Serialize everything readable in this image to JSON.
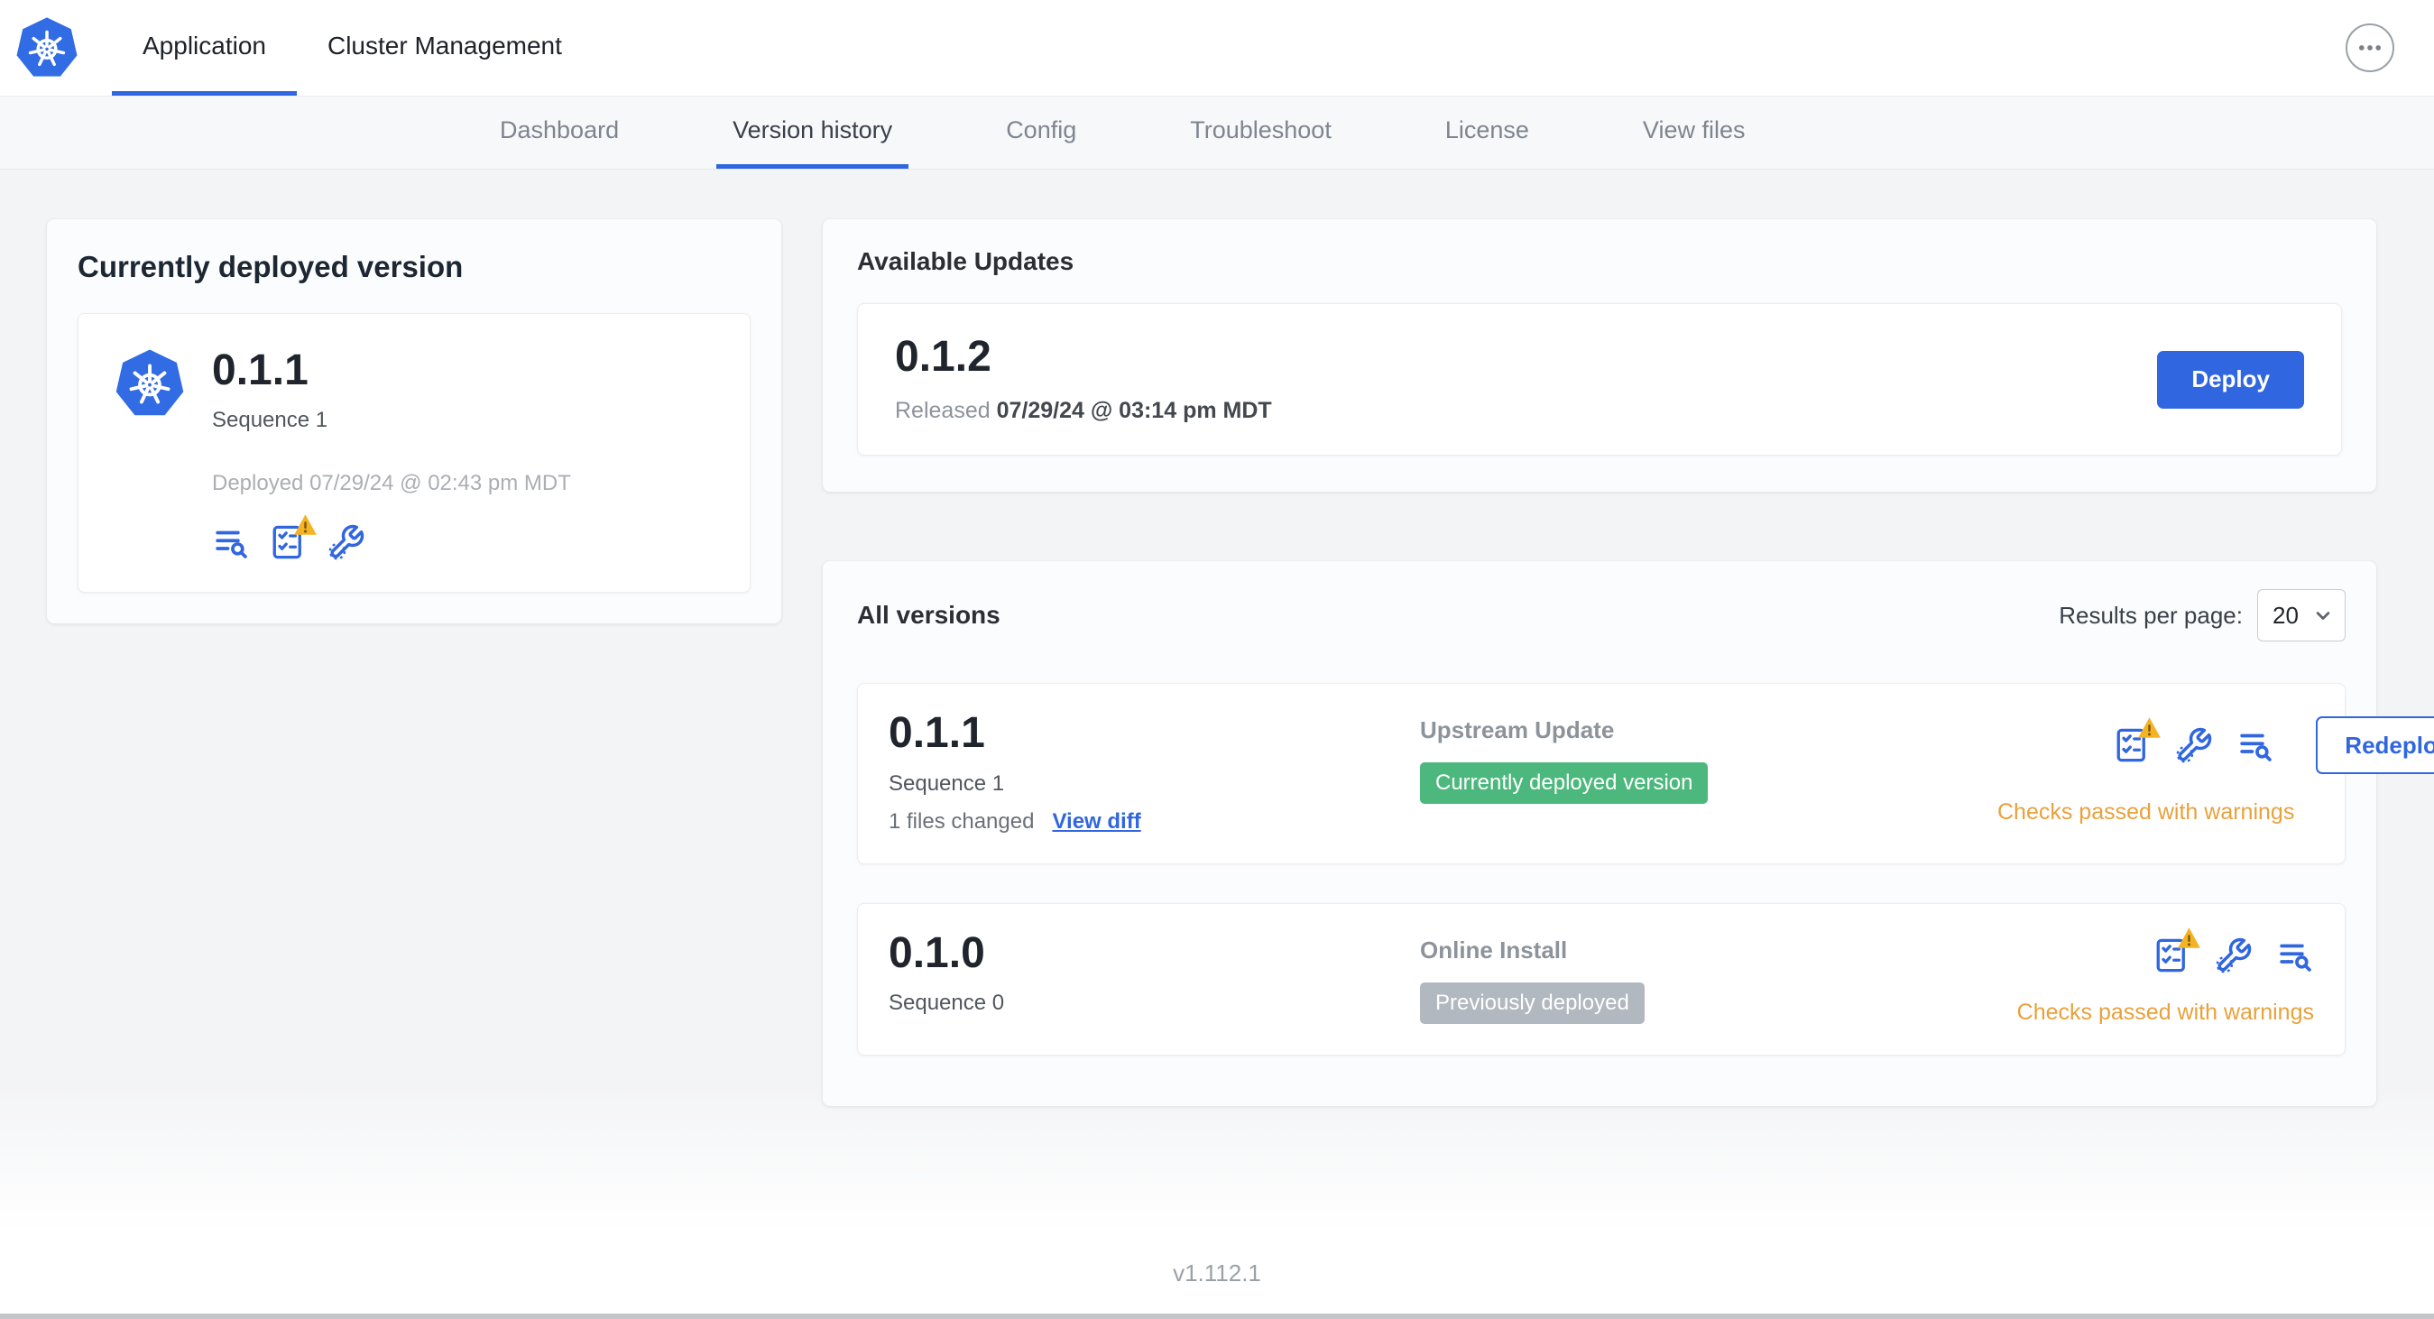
{
  "header": {
    "nav": [
      {
        "label": "Application",
        "active": true
      },
      {
        "label": "Cluster Management",
        "active": false
      }
    ],
    "overflow_menu_icon": "ellipsis-icon"
  },
  "subnav": {
    "items": [
      "Dashboard",
      "Version history",
      "Config",
      "Troubleshoot",
      "License",
      "View files"
    ],
    "active": "Version history"
  },
  "deployed_card": {
    "title": "Currently deployed version",
    "version": "0.1.1",
    "sequence": "Sequence 1",
    "deployed_at": "Deployed 07/29/24 @ 02:43 pm MDT",
    "icons": [
      "release-notes-icon",
      "preflight-checks-warning-icon",
      "config-wrench-icon"
    ]
  },
  "available_updates": {
    "title": "Available Updates",
    "version": "0.1.2",
    "released_label": "Released",
    "released_at": "07/29/24 @ 03:14 pm MDT",
    "deploy_button": "Deploy"
  },
  "all_versions": {
    "title": "All versions",
    "results_per_page_label": "Results per page:",
    "results_per_page_value": "20",
    "rows": [
      {
        "version": "0.1.1",
        "sequence": "Sequence 1",
        "files_changed": "1 files changed",
        "view_diff": "View diff",
        "source": "Upstream Update",
        "badge": "Currently deployed version",
        "badge_style": "green",
        "action_button": "Redeploy",
        "status": "Checks passed with warnings",
        "icons": [
          "preflight-checks-warning-icon",
          "config-wrench-icon",
          "release-notes-icon"
        ]
      },
      {
        "version": "0.1.0",
        "sequence": "Sequence 0",
        "source": "Online Install",
        "badge": "Previously deployed",
        "badge_style": "gray",
        "status": "Checks passed with warnings",
        "icons": [
          "preflight-checks-warning-icon",
          "config-wrench-icon",
          "release-notes-icon"
        ]
      }
    ]
  },
  "footer": {
    "app_version": "v1.112.1"
  },
  "colors": {
    "accent_blue": "#3066E0",
    "kubernetes_blue": "#326CE5",
    "badge_green": "#4DB87D",
    "badge_gray": "#B2B8BF",
    "warning_orange": "#E9A13B",
    "warning_triangle_yellow": "#F5B324"
  }
}
